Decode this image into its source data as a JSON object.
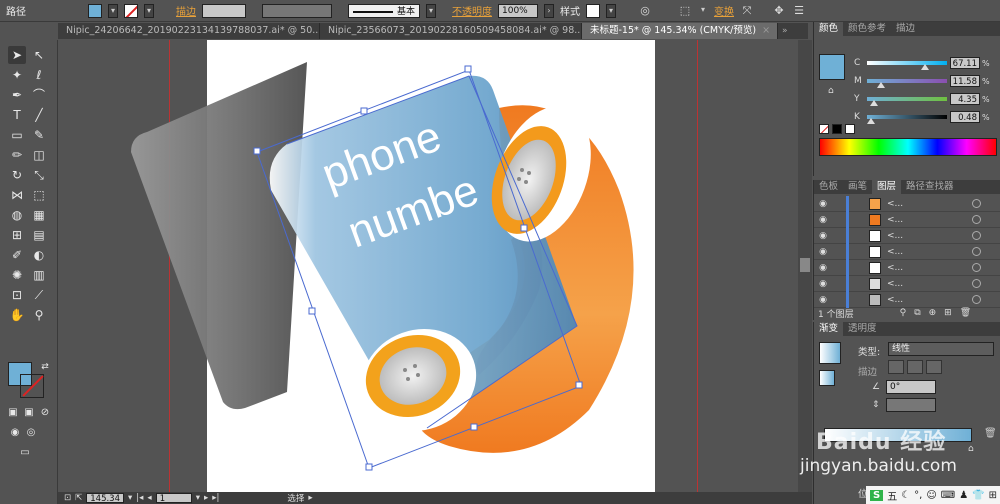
{
  "control_bar": {
    "object_type": "路径",
    "stroke_label": "描边",
    "opacity_label": "不透明度",
    "opacity_value": "100%",
    "brush_label": "基本",
    "style_label": "样式",
    "transform_label": "变换",
    "fill_color": "#6fb0d6",
    "stroke_none_color": "#d22"
  },
  "tabs": [
    {
      "label": "Nipic_24206642_20190223134139788037.ai* @ 50..."
    },
    {
      "label": "Nipic_23566073_20190228160509458084.ai* @ 98..."
    },
    {
      "label": "未标题-15* @ 145.34% (CMYK/预览)"
    }
  ],
  "canvas_text": {
    "line1": "phone",
    "line2": "numbe"
  },
  "status": {
    "zoom": "145.34",
    "artboard": "1",
    "tool": "选择"
  },
  "color_panel": {
    "tabs": [
      "颜色",
      "颜色参考",
      "描边"
    ],
    "channels": [
      {
        "ch": "C",
        "value": "67.11",
        "pos": 0.67
      },
      {
        "ch": "M",
        "value": "11.58",
        "pos": 0.12
      },
      {
        "ch": "Y",
        "value": "4.35",
        "pos": 0.04
      },
      {
        "ch": "K",
        "value": "0.48",
        "pos": 0.0
      }
    ],
    "pct": "%"
  },
  "layers_panel": {
    "tabs": [
      "色板",
      "画笔",
      "图层",
      "路径查找器"
    ],
    "rows": [
      "<...",
      "<...",
      "<...",
      "<...",
      "<...",
      "<...",
      "<..."
    ],
    "count_label": "1 个图层"
  },
  "gradient_panel": {
    "tabs": [
      "渐变",
      "透明度"
    ],
    "type_label": "类型:",
    "type_value": "线性",
    "stroke_label": "描边",
    "angle_value": "0°",
    "position_label": "位置"
  },
  "watermark": {
    "line1": "Baidu 经验",
    "line2": "jingyan.baidu.com"
  },
  "taskbar": {
    "ime": "五"
  }
}
